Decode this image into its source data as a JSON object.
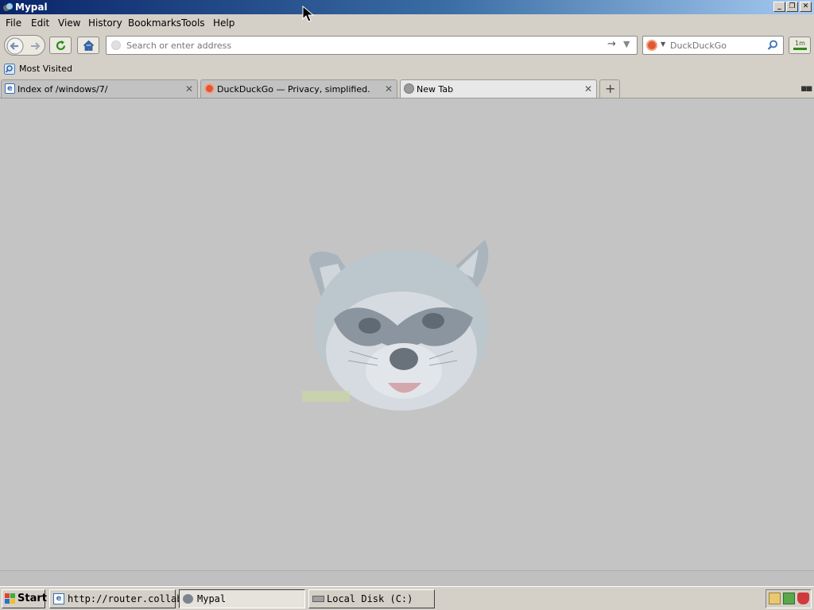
{
  "window": {
    "title": "Mypal"
  },
  "menu": {
    "items": [
      {
        "label": "File"
      },
      {
        "label": "Edit"
      },
      {
        "label": "View"
      },
      {
        "label": "History"
      },
      {
        "label": "Bookmarks"
      },
      {
        "label": "Tools"
      },
      {
        "label": "Help"
      }
    ]
  },
  "toolbar": {
    "url_placeholder": "Search or enter address",
    "search_placeholder": "DuckDuckGo",
    "download_label": "1m"
  },
  "bookmarks": {
    "most_visited": "Most Visited"
  },
  "tabs": [
    {
      "title": "Index of /windows/7/",
      "active": false
    },
    {
      "title": "DuckDuckGo — Privacy, simplified.",
      "active": false
    },
    {
      "title": "New Tab",
      "active": true
    }
  ],
  "content": {
    "logo": "raccoon-mascot-image"
  },
  "taskbar": {
    "start_label": "Start",
    "tasks": [
      {
        "label": "http://router.collab..."
      },
      {
        "label": "Mypal"
      },
      {
        "label": "Local Disk (C:)"
      }
    ]
  },
  "colors": {
    "titlebar_start": "#0a246a",
    "titlebar_end": "#a6caf0",
    "chrome": "#d4d0c8",
    "content_bg": "#c4c4c4",
    "accent_green": "#2e8b1e",
    "ddg_orange": "#de5833"
  }
}
